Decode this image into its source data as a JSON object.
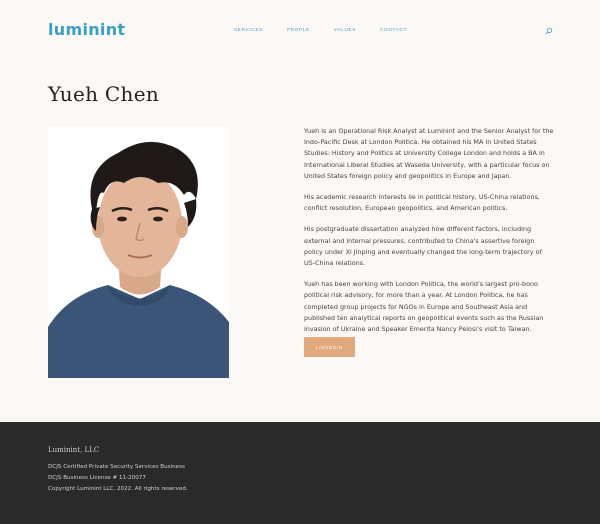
{
  "header": {
    "logo": "luminint",
    "nav": [
      "SERVICES",
      "PEOPLE",
      "VALUES",
      "CONTACT"
    ]
  },
  "page": {
    "title": "Yueh Chen"
  },
  "bio": {
    "paragraphs": [
      "Yueh is an Operational Risk Analyst at Luminint and the Senior Analyst for the Indo-Pacific Desk at London Politica. He obtained his MA in United States Studies: History and Politics at University College London and holds a BA in International Liberal Studies at Waseda University, with a particular focus on United States foreign policy and geopolitics in Europe and Japan.",
      "His academic research interests lie in political history, US-China relations, conflict resolution, European geopolitics, and American politics.",
      "His postgraduate dissertation analyzed how different factors, including external and internal pressures, contributed to China's assertive foreign policy under Xi Jinping and eventually changed the long-term trajectory of US-China relations.",
      "Yueh has been working with London Politica, the world's largest pro-bono political risk advisory, for more than a year. At London Politica, he has completed group projects for NGOs in Europe and Southeast Asia and published ten analytical reports on geopolitical events such as the Russian invasion of Ukraine and Speaker Emerita Nancy Pelosi's visit to Taiwan."
    ],
    "linkedin_label": "LINKEDIN"
  },
  "footer": {
    "company": "Luminint, LLC",
    "line1": "DCJS Certified Private Security Services Business",
    "line2": "DCJS Business License # 11-20077",
    "line3": "Copyright Luminint LLC, 2022. All rights reserved."
  },
  "colors": {
    "accent": "#3a9fc4",
    "button": "#e2aa7c",
    "footer_bg": "#2a2a2a",
    "page_bg": "#fcf8f6"
  },
  "icons": {
    "search": "search-icon"
  }
}
